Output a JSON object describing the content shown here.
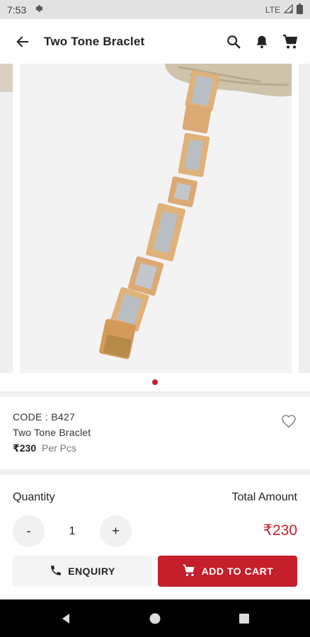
{
  "status_bar": {
    "time": "7:53",
    "network": "LTE"
  },
  "app_bar": {
    "title": "Two Tone Braclet"
  },
  "carousel": {
    "slide_count": 1,
    "active_index": 0
  },
  "product": {
    "code": "CODE : B427",
    "name": "Two Tone Braclet",
    "price": "₹230",
    "unit": "Per Pcs"
  },
  "order": {
    "quantity_label": "Quantity",
    "total_label": "Total Amount",
    "decrement_label": "-",
    "increment_label": "+",
    "quantity": "1",
    "total": "₹230",
    "enquiry_label": "ENQUIRY",
    "add_to_cart_label": "ADD TO CART"
  },
  "colors": {
    "accent": "#c41f2a",
    "button_bg": "#f4f4f4",
    "gold": "#d9a86a",
    "silver": "#b9bec4"
  }
}
